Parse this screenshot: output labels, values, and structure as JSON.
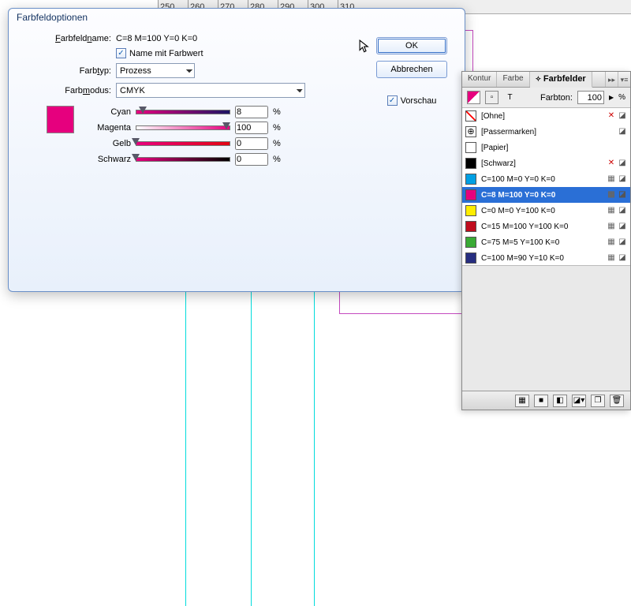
{
  "ruler": {
    "start": 250,
    "step": 10,
    "count": 7
  },
  "dialog": {
    "title": "Farbfeldoptionen",
    "name_label": "Farbfeldname:",
    "name_value": "C=8 M=100 Y=0 K=0",
    "name_with_value_label": "Name mit Farbwert",
    "name_with_value_checked": true,
    "type_label": "Farbtyp:",
    "type_value": "Prozess",
    "mode_label": "Farbmodus:",
    "mode_value": "CMYK",
    "preview_label": "Vorschau",
    "preview_checked": true,
    "ok": "OK",
    "cancel": "Abbrechen",
    "swatch_color": "#e6007e",
    "sliders": {
      "cyan": {
        "label": "Cyan",
        "value": "8",
        "pct": "%"
      },
      "magenta": {
        "label": "Magenta",
        "value": "100",
        "pct": "%"
      },
      "gelb": {
        "label": "Gelb",
        "value": "0",
        "pct": "%"
      },
      "schwarz": {
        "label": "Schwarz",
        "value": "0",
        "pct": "%"
      }
    }
  },
  "panel": {
    "tabs": {
      "kontur": "Kontur",
      "farbe": "Farbe",
      "farbfelder": "Farbfelder"
    },
    "farbton_label": "Farbton:",
    "farbton_value": "100",
    "pct": "%",
    "swatches": [
      {
        "name": "[Ohne]",
        "chip": "none",
        "locked": true,
        "editable": true
      },
      {
        "name": "[Passermarken]",
        "chip": "reg",
        "locked": false,
        "editable": true
      },
      {
        "name": "[Papier]",
        "chip": "#ffffff",
        "locked": false,
        "editable": false
      },
      {
        "name": "[Schwarz]",
        "chip": "#000000",
        "locked": true,
        "editable": true
      },
      {
        "name": "C=100 M=0 Y=0 K=0",
        "chip": "#009fe3",
        "cmyk": true
      },
      {
        "name": "C=8 M=100 Y=0 K=0",
        "chip": "#e6007e",
        "cmyk": true,
        "selected": true
      },
      {
        "name": "C=0 M=0 Y=100 K=0",
        "chip": "#ffed00",
        "cmyk": true
      },
      {
        "name": "C=15 M=100 Y=100 K=0",
        "chip": "#c00d1e",
        "cmyk": true
      },
      {
        "name": "C=75 M=5 Y=100 K=0",
        "chip": "#3aaa35",
        "cmyk": true
      },
      {
        "name": "C=100 M=90 Y=10 K=0",
        "chip": "#272e80",
        "cmyk": true
      }
    ]
  }
}
